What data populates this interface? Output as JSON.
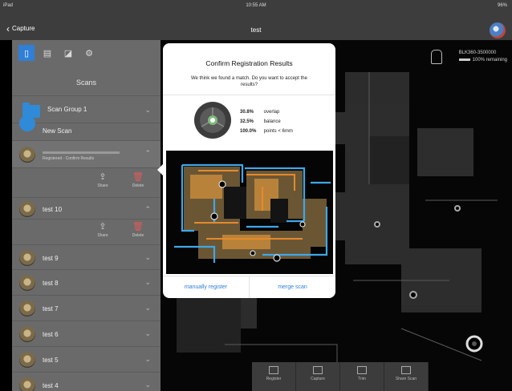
{
  "status": {
    "carrier": "iPad",
    "time": "10:55 AM",
    "battery": "96%"
  },
  "nav": {
    "back_label": "Capture",
    "title": "test"
  },
  "scan_info": {
    "id": "BLK360-3500000",
    "remaining": "100% remaining"
  },
  "sidebar": {
    "heading": "Scans",
    "group": {
      "label": "Scan Group 1"
    },
    "new_scan": "New Scan",
    "registering_status": "Registered - Confirm Results",
    "share_label": "Share",
    "delete_label": "Delete",
    "scans": [
      {
        "label": "test 10"
      },
      {
        "label": "test 9"
      },
      {
        "label": "test 8"
      },
      {
        "label": "test 7"
      },
      {
        "label": "test 6"
      },
      {
        "label": "test 5"
      },
      {
        "label": "test 4"
      }
    ]
  },
  "toolbar": {
    "items": [
      {
        "label": "Register",
        "icon": "register-icon"
      },
      {
        "label": "Capture",
        "icon": "camera-icon"
      },
      {
        "label": "Trim",
        "icon": "trim-icon"
      },
      {
        "label": "Share Scan",
        "icon": "share-icon"
      }
    ]
  },
  "modal": {
    "title": "Confirm Registration Results",
    "description": "We think we found a match. Do you want to accept the results?",
    "stats": [
      {
        "value": "30.8%",
        "label": "overlap"
      },
      {
        "value": "32.5%",
        "label": "balance"
      },
      {
        "value": "100.0%",
        "label": "points < 6mm"
      }
    ],
    "manual_label": "manually register",
    "merge_label": "merge scan"
  },
  "colors": {
    "accent": "#2f7fd6",
    "panel": "#6a6a6a",
    "delete": "#e05a5a"
  }
}
